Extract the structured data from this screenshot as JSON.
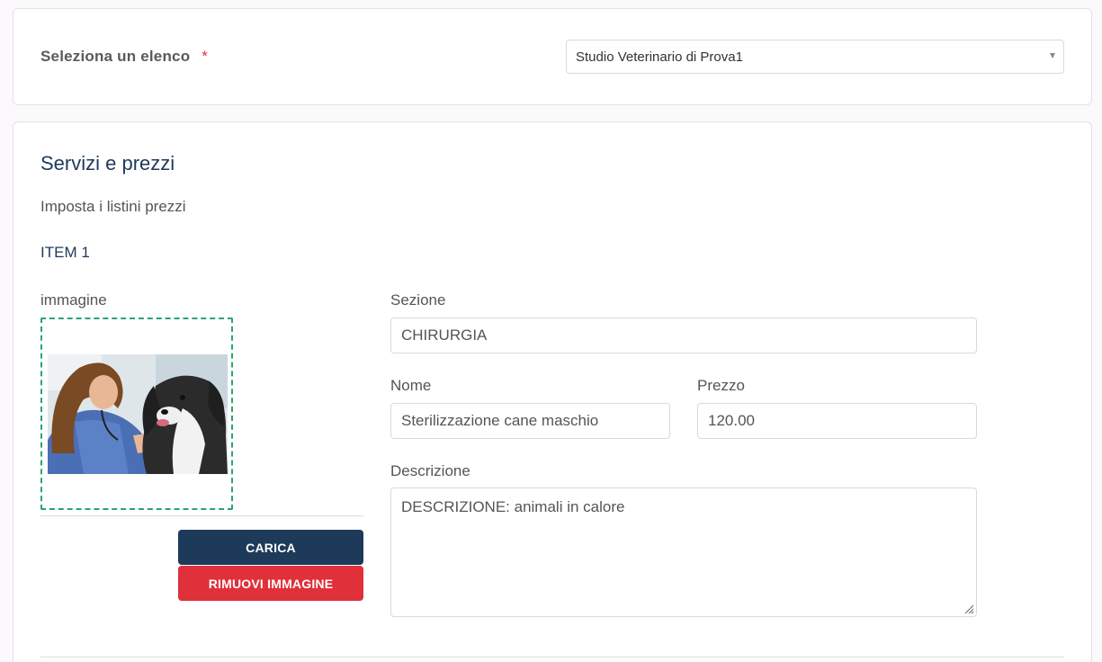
{
  "list_selector": {
    "label": "Seleziona un elenco",
    "required_mark": "*",
    "selected": "Studio Veterinario di Prova1"
  },
  "section": {
    "title": "Servizi e prezzi",
    "subtitle": "Imposta i listini prezzi",
    "item_title": "ITEM 1"
  },
  "image": {
    "label": "immagine",
    "upload_label": "CARICA",
    "remove_label": "RIMUOVI IMMAGINE"
  },
  "fields": {
    "sezione_label": "Sezione",
    "sezione_value": "CHIRURGIA",
    "nome_label": "Nome",
    "nome_value": "Sterilizzazione cane maschio",
    "prezzo_label": "Prezzo",
    "prezzo_value": "120.00",
    "descrizione_label": "Descrizione",
    "descrizione_value": "DESCRIZIONE: animali in calore"
  },
  "colors": {
    "primary": "#1d3a5b",
    "danger": "#e0303a",
    "dropzone_border": "#2aa56e",
    "required": "#e0343c"
  }
}
